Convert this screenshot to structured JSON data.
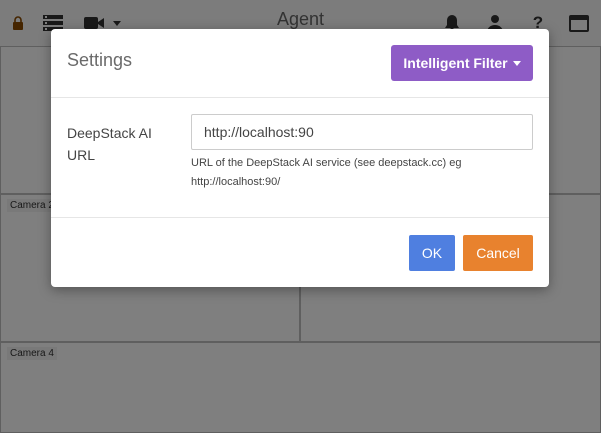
{
  "app": {
    "title": "Agent",
    "toolbar_icons": [
      "lock-icon",
      "server-icon",
      "video-camera-icon",
      "bell-icon",
      "user-icon",
      "help-icon",
      "window-icon"
    ]
  },
  "cameras": [
    {
      "label": "Camera 2"
    },
    {
      "label": "Camera 4"
    }
  ],
  "modal": {
    "title": "Settings",
    "filter_button": "Intelligent Filter",
    "field_label": "DeepStack AI URL",
    "url_value": "http://localhost:90",
    "help_text": "URL of the DeepStack AI service (see deepstack.cc) eg http://localhost:90/",
    "ok_label": "OK",
    "cancel_label": "Cancel"
  },
  "colors": {
    "filter_button": "#8e5cc6",
    "ok_button": "#4f7fe0",
    "cancel_button": "#e8822e",
    "overlay": "rgba(0,0,0,0.5)"
  }
}
